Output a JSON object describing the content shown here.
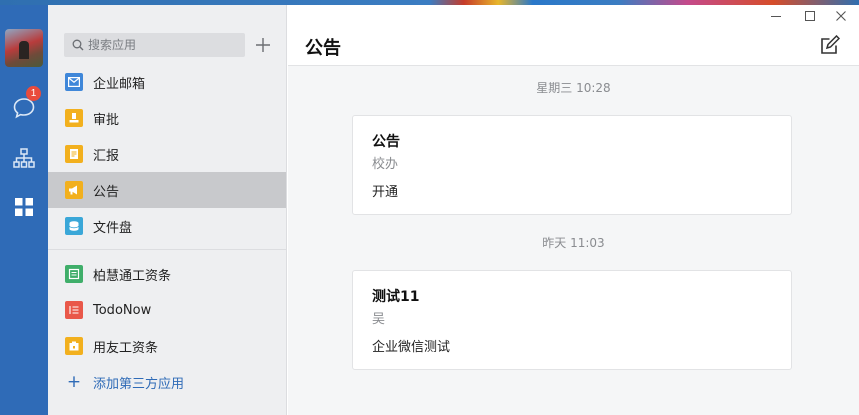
{
  "sidebar": {
    "search_placeholder": "搜索应用",
    "apps": [
      {
        "label": "企业邮箱",
        "icon": "mail-icon",
        "color": "#3f87d9"
      },
      {
        "label": "审批",
        "icon": "approval-icon",
        "color": "#f2b01e"
      },
      {
        "label": "汇报",
        "icon": "report-icon",
        "color": "#f2b01e"
      },
      {
        "label": "公告",
        "icon": "announcement-icon",
        "color": "#f2b01e",
        "active": true
      },
      {
        "label": "文件盘",
        "icon": "file-drive-icon",
        "color": "#3aa7d8"
      }
    ],
    "third_party_apps": [
      {
        "label": "柏慧通工资条",
        "icon": "payslip-icon",
        "color": "#3fae6a"
      },
      {
        "label": "TodoNow",
        "icon": "todo-icon",
        "color": "#e9584a"
      },
      {
        "label": "用友工资条",
        "icon": "payslip-icon",
        "color": "#f2b01e"
      }
    ],
    "add_third_party_label": "添加第三方应用"
  },
  "nav": {
    "chat_badge": "1",
    "accent_color": "#2f6bb7"
  },
  "main": {
    "title": "公告",
    "posts": [
      {
        "timestamp": "星期三 10:28",
        "title": "公告",
        "author": "校办",
        "body": "开通"
      },
      {
        "timestamp": "昨天 11:03",
        "title": "测试11",
        "author": "吴",
        "body": "企业微信测试"
      }
    ]
  }
}
